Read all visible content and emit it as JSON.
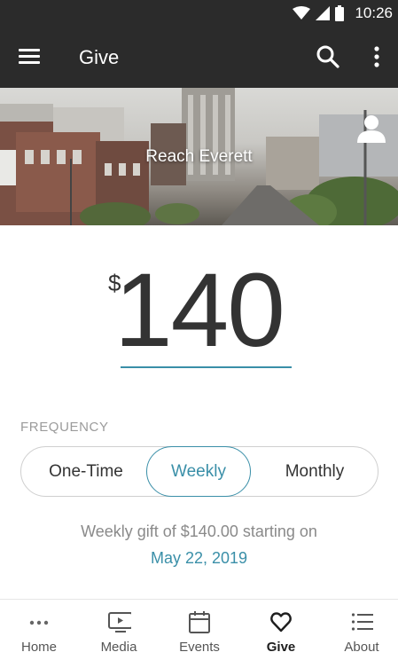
{
  "status_bar": {
    "time": "10:26"
  },
  "app_bar": {
    "title": "Give"
  },
  "hero": {
    "title": "Reach Everett"
  },
  "amount": {
    "currency": "$",
    "value": "140"
  },
  "frequency": {
    "label": "FREQUENCY",
    "options": [
      "One-Time",
      "Weekly",
      "Monthly"
    ],
    "selected": "Weekly"
  },
  "summary": {
    "text": "Weekly gift of $140.00 starting on",
    "date": "May 22, 2019"
  },
  "bottom_nav": {
    "items": [
      {
        "label": "Home",
        "icon": "more-dots-icon"
      },
      {
        "label": "Media",
        "icon": "video-icon"
      },
      {
        "label": "Events",
        "icon": "calendar-icon"
      },
      {
        "label": "Give",
        "icon": "heart-icon"
      },
      {
        "label": "About",
        "icon": "list-icon"
      }
    ],
    "active": "Give"
  },
  "colors": {
    "accent": "#3a8fa8",
    "app_bar": "#2b2b2b"
  }
}
